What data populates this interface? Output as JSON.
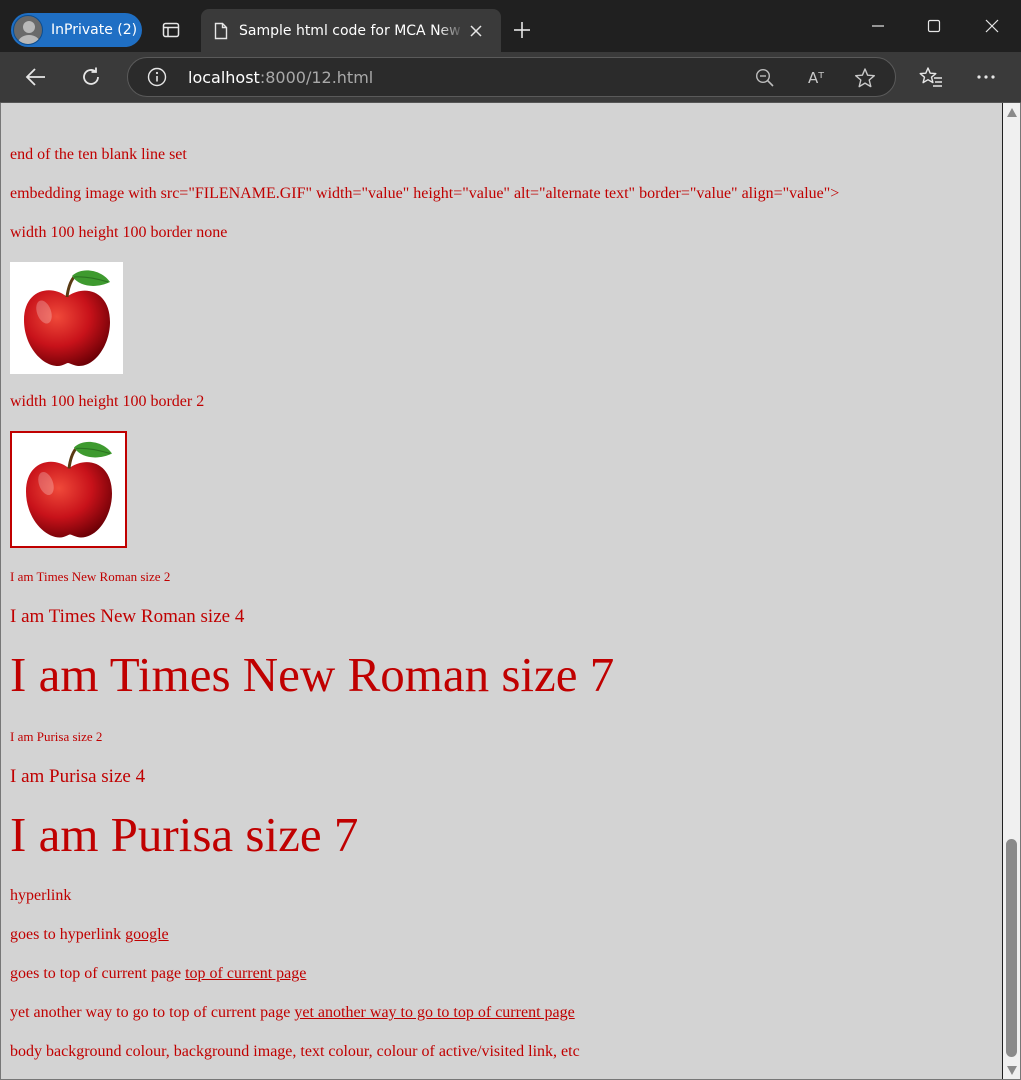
{
  "browser": {
    "profile_label": "InPrivate (2)",
    "tab_title": "Sample html code for MCA New Students",
    "url_host": "localhost",
    "url_rest": ":8000/12.html",
    "read_aloud_glyph": "Aᵀ"
  },
  "page": {
    "line_end": "end of the ten blank line set",
    "line_embed": "embedding image with src=\"FILENAME.GIF\" width=\"value\" height=\"value\" alt=\"alternate text\" border=\"value\" align=\"value\">",
    "line_w100_none": "width 100 height 100 border none",
    "line_w100_2": "width 100 height 100 border 2",
    "times2": "I am Times New Roman size 2",
    "times4": "I am Times New Roman size 4",
    "times7": "I am Times New Roman size 7",
    "purisa2": "I am Purisa size 2",
    "purisa4": "I am Purisa size 4",
    "purisa7": "I am Purisa size 7",
    "hyperlink": "hyperlink",
    "goes_to_text": "goes to hyperlink ",
    "goes_to_link": "google",
    "top_text": "goes to top of current page ",
    "top_link": "top of current page",
    "another_text": "yet another way to go to top of current page ",
    "another_link": "yet another way to go to top of current page",
    "body_bg": "body background colour, background image, text colour, colour of active/visited link, etc"
  },
  "colors": {
    "page_background": "#d3d3d3",
    "text": "#c00000",
    "profile_pill": "#1f6fc4"
  },
  "icons": [
    "tab-actions-icon",
    "document-icon",
    "close-icon",
    "plus-icon",
    "minimize-icon",
    "maximize-icon",
    "back-icon",
    "refresh-icon",
    "info-icon",
    "zoom-out-icon",
    "read-aloud-icon",
    "favorite-star-icon",
    "favorites-icon",
    "more-icon",
    "apple-image"
  ]
}
